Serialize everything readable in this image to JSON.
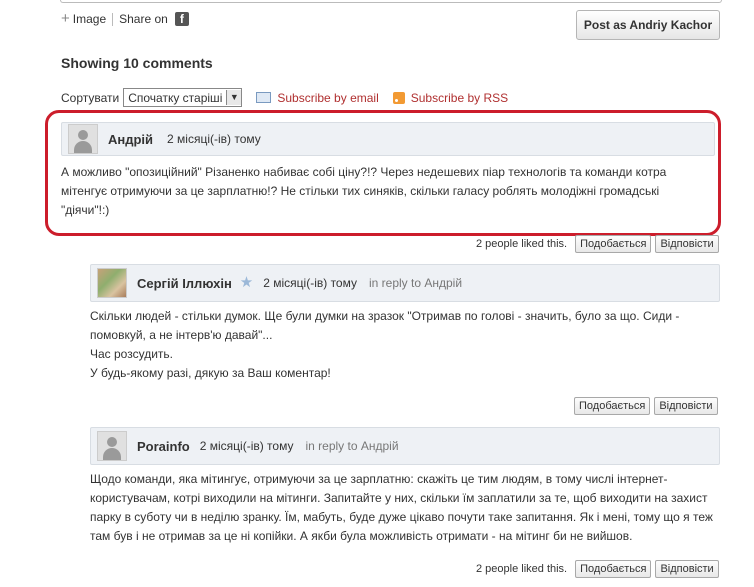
{
  "composer": {
    "image_label": "Image",
    "share_label": "Share on",
    "facebook_glyph": "f",
    "post_button": "Post as Andriy Kachor"
  },
  "comments_header": {
    "showing": "Showing 10 comments",
    "sort_label": "Сортувати",
    "sort_value": "Спочатку старіші",
    "subscribe_email": "Subscribe by email",
    "subscribe_rss": "Subscribe by RSS"
  },
  "comments": [
    {
      "author": "Андрій",
      "time": "2 місяці(-ів) тому",
      "lines": [
        "А можливо \"опозиційний\" Різаненко набиває собі ціну?!? Через недешевих піар технологів та команди котра",
        "мітенгує отримуючи за це зарплатню!? Не стільки тих синяків, скільки  галасу роблять молодіжні громадські",
        "\"діячи\"!:)"
      ],
      "likes": "2 people liked this.",
      "like_btn": "Подобається",
      "reply_btn": "Відповісти"
    },
    {
      "author": "Сергій Іллюхін",
      "time": "2 місяці(-ів) тому",
      "reply_prefix": "in reply to",
      "reply_to": "Андрій",
      "lines": [
        "Скільки людей - стільки думок. Ще були думки на зразок \"Отримав по голові - значить, було за що. Сиди -",
        "помовкуй, а не інтерв'ю давай\"...",
        "Час розсудить.",
        "У будь-якому разі, дякую за Ваш коментар!"
      ],
      "like_btn": "Подобається",
      "reply_btn": "Відповісти"
    },
    {
      "author": "Porainfo",
      "time": "2 місяці(-ів) тому",
      "reply_prefix": "in reply to",
      "reply_to": "Андрій",
      "lines": [
        "Щодо команди, яка мітингує, отримуючи за це зарплатню: скажіть це тим людям, в тому числі інтернет-",
        "користувачам, котрі виходили на мітинги. Запитайте у них, скільки їм заплатили за те, щоб виходити на захист",
        "парку в суботу чи в неділю зранку. Їм, мабуть, буде дуже цікаво почути таке запитання. Як і мені, тому що я теж",
        "там був і не отримав за це ні копійки. А якби була можливість отримати - на мітинг би не вийшов."
      ],
      "likes": "2 people liked this.",
      "like_btn": "Подобається",
      "reply_btn": "Відповісти"
    }
  ]
}
